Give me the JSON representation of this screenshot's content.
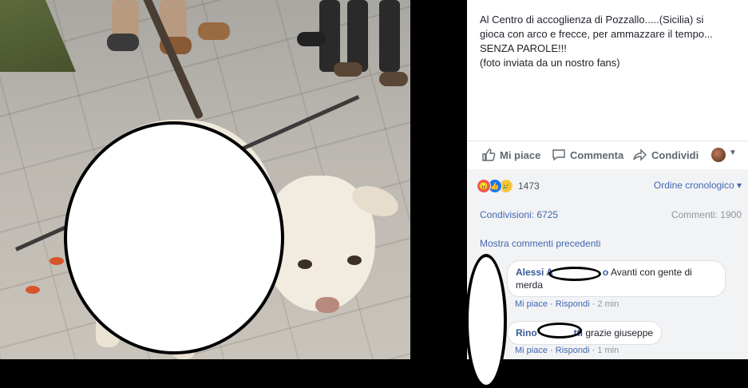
{
  "post": {
    "lines": [
      "Al Centro di accoglienza di Pozzallo.....(Sicilia) si",
      "gioca con arco e frecce, per ammazzare il tempo...",
      "SENZA PAROLE!!!",
      "(foto inviata da un nostro fans)"
    ]
  },
  "actions": {
    "like": "Mi piace",
    "comment": "Commenta",
    "share": "Condividi"
  },
  "reactions": {
    "icons": [
      "angry-icon",
      "like-icon",
      "sad-icon"
    ],
    "count": "1473",
    "order_label": "Ordine cronologico ▾"
  },
  "stats": {
    "shares": "Condivisioni: 6725",
    "comments": "Commenti: 1900"
  },
  "more_comments": "Mostra commenti precedenti",
  "comments": [
    {
      "author": "Alessi A",
      "author_tail": "o",
      "text_line1": "Avanti con gente di",
      "text_line2": "merda",
      "like": "Mi piace",
      "reply": "Rispondi",
      "time": "2 min"
    },
    {
      "author": "Rino",
      "author_tail": "tti",
      "text": "grazie giuseppe",
      "like": "Mi piace",
      "reply": "Rispondi",
      "time": "1 min"
    }
  ],
  "colors": {
    "link": "#4267b2",
    "author": "#385898",
    "panel_bg": "#f2f3f5"
  }
}
